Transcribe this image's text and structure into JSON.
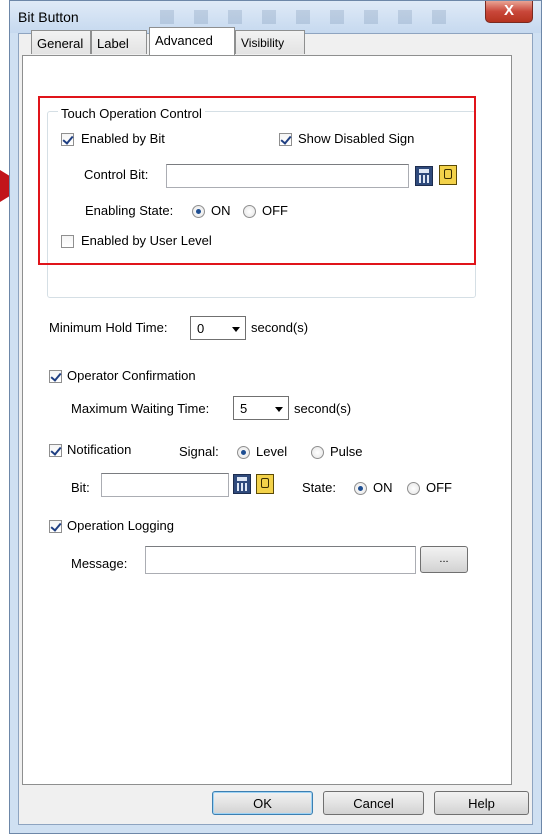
{
  "window": {
    "title": "Bit Button",
    "close_glyph": "X"
  },
  "tabs": [
    {
      "label": "General",
      "active": false
    },
    {
      "label": "Label",
      "active": false
    },
    {
      "label": "Advanced",
      "active": true
    },
    {
      "label": "Visibility",
      "active": false
    }
  ],
  "touch_group": {
    "title": "Touch Operation Control",
    "enabled_by_bit": {
      "label": "Enabled by Bit",
      "checked": true
    },
    "show_disabled_sign": {
      "label": "Show Disabled Sign",
      "checked": true
    },
    "control_bit": {
      "label": "Control Bit:",
      "value": ""
    },
    "enabling_state": {
      "label": "Enabling State:",
      "on_label": "ON",
      "off_label": "OFF",
      "selected": "ON"
    },
    "enabled_by_user_level": {
      "label": "Enabled by User Level",
      "checked": false
    }
  },
  "min_hold": {
    "label": "Minimum Hold Time:",
    "value": "0",
    "unit": "second(s)"
  },
  "operator_confirmation": {
    "label": "Operator Confirmation",
    "checked": true,
    "max_wait_label": "Maximum Waiting Time:",
    "max_wait_value": "5",
    "unit": "second(s)"
  },
  "notification": {
    "label": "Notification",
    "checked": true,
    "signal_label": "Signal:",
    "level_label": "Level",
    "pulse_label": "Pulse",
    "signal_selected": "Level",
    "bit_label": "Bit:",
    "bit_value": "",
    "state_label": "State:",
    "on_label": "ON",
    "off_label": "OFF",
    "state_selected": "ON"
  },
  "operation_logging": {
    "label": "Operation Logging",
    "checked": true,
    "message_label": "Message:",
    "message_value": "",
    "browse_label": "..."
  },
  "buttons": {
    "ok": "OK",
    "cancel": "Cancel",
    "help": "Help"
  },
  "colors": {
    "highlight": "#e0141a",
    "radio_dot": "#1e4e92"
  }
}
